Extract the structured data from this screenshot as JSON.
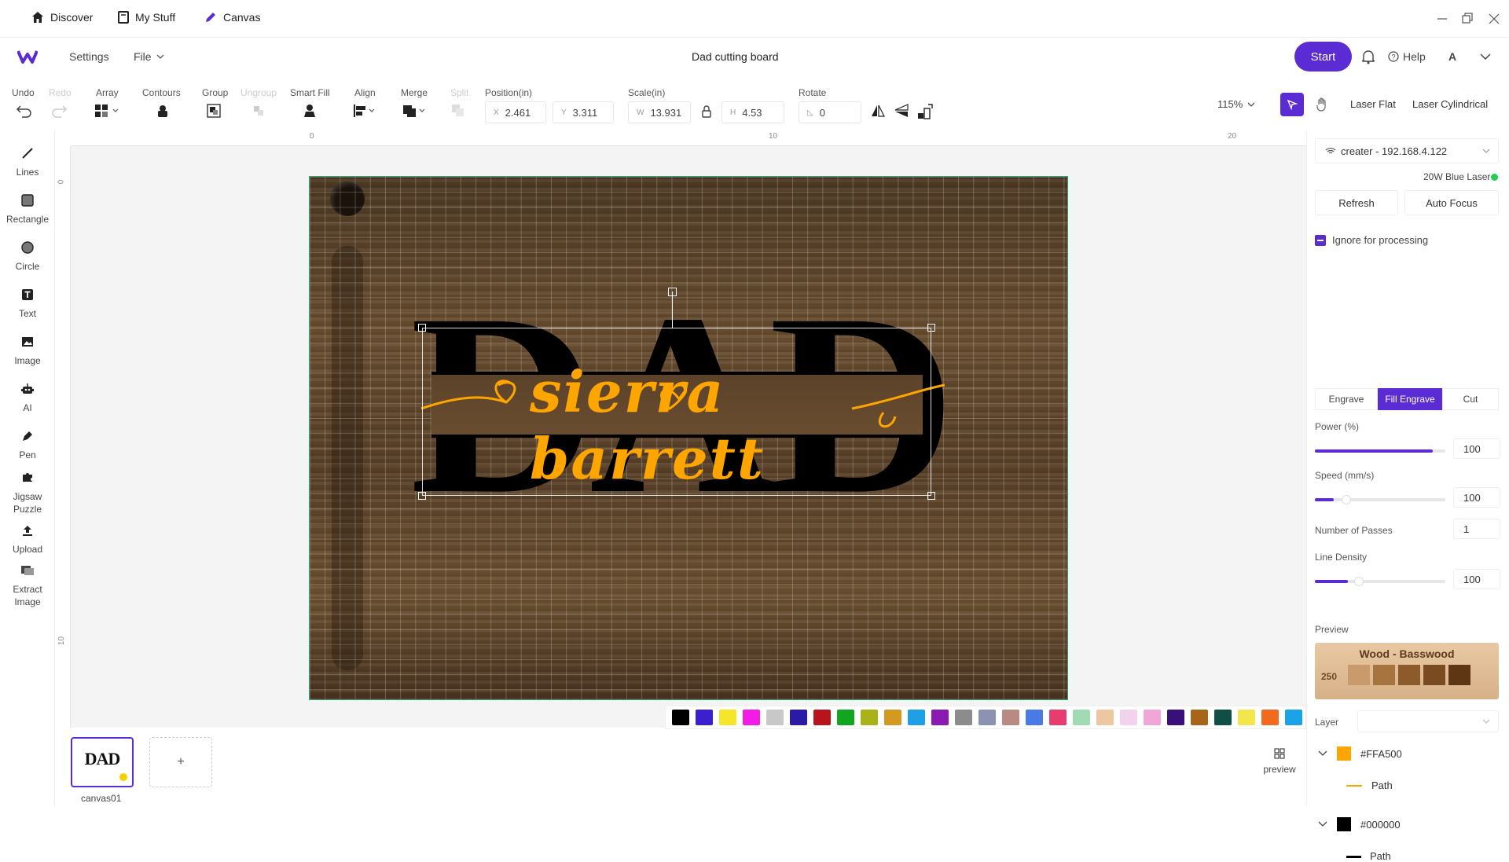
{
  "titlebar": {
    "nav": [
      {
        "label": "Discover",
        "icon": "home-icon"
      },
      {
        "label": "My Stuff",
        "icon": "book-icon"
      },
      {
        "label": "Canvas",
        "icon": "pencil-icon"
      }
    ]
  },
  "header": {
    "menu_settings": "Settings",
    "menu_file": "File",
    "project_title": "Dad cutting board",
    "start_label": "Start",
    "help_label": "Help",
    "account_letter": "A"
  },
  "toolbar": {
    "undo": "Undo",
    "redo": "Redo",
    "array": "Array",
    "contours": "Contours",
    "group": "Group",
    "ungroup": "Ungroup",
    "smart_fill": "Smart Fill",
    "align": "Align",
    "merge": "Merge",
    "split": "Split",
    "position_label": "Position(in)",
    "pos_x_prefix": "X",
    "pos_x": "2.461",
    "pos_y_prefix": "Y",
    "pos_y": "3.311",
    "scale_label": "Scale(in)",
    "scale_w_prefix": "W",
    "scale_w": "13.931",
    "scale_h_prefix": "H",
    "scale_h": "4.53",
    "rotate_label": "Rotate",
    "rotate_value": "0",
    "zoom": "115%",
    "mode_flat": "Laser Flat",
    "mode_cyl": "Laser Cylindrical"
  },
  "tools": [
    {
      "label": "Lines",
      "icon": "line-icon"
    },
    {
      "label": "Rectangle",
      "icon": "rectangle-icon"
    },
    {
      "label": "Circle",
      "icon": "circle-icon"
    },
    {
      "label": "Text",
      "icon": "text-icon"
    },
    {
      "label": "Image",
      "icon": "image-icon"
    },
    {
      "label": "AI",
      "icon": "robot-icon"
    },
    {
      "label": "Pen",
      "icon": "pen-icon"
    },
    {
      "label": "Jigsaw Puzzle",
      "icon": "puzzle-icon"
    },
    {
      "label": "Upload",
      "icon": "upload-icon"
    },
    {
      "label": "Extract Image",
      "icon": "extract-icon"
    }
  ],
  "rulers": {
    "top": [
      "0",
      "10",
      "20"
    ],
    "left": [
      "0",
      "10"
    ]
  },
  "design": {
    "main_text": "DAD",
    "script_text": "sierra barrett"
  },
  "palette": [
    "#000000",
    "#3b1fd1",
    "#f5e62b",
    "#f21ce6",
    "#c8c8c8",
    "#2b1aa8",
    "#b8141c",
    "#12a51f",
    "#a9b217",
    "#d39a1f",
    "#1ea0e6",
    "#8a1ab2",
    "#8c8c8c",
    "#8c93b2",
    "#b88a82",
    "#4b7ae6",
    "#e63c6e",
    "#9fdcb4",
    "#ecc8a0",
    "#f2d2ec",
    "#f2a6d8",
    "#3a0f7a",
    "#a8651a",
    "#0f4f46",
    "#f2e64a",
    "#f26a1e",
    "#1aa3e6"
  ],
  "canvas_tabs": [
    {
      "label": "canvas01"
    }
  ],
  "add_canvas": "+",
  "preview_button": "preview",
  "device": {
    "name": "creater - 192.168.4.122",
    "laser": "20W Blue Laser",
    "refresh": "Refresh",
    "autofocus": "Auto Focus"
  },
  "processing": {
    "ignore_label": "Ignore for processing",
    "tabs": [
      "Engrave",
      "Fill Engrave",
      "Cut"
    ],
    "active_tab": 1,
    "power_label": "Power (%)",
    "power_value": "100",
    "speed_label": "Speed (mm/s)",
    "speed_value": "100",
    "passes_label": "Number of Passes",
    "passes_value": "1",
    "density_label": "Line Density",
    "density_value": "100"
  },
  "preview": {
    "label": "Preview",
    "material": "Wood - Basswood",
    "num": "250"
  },
  "layers": {
    "label": "Layer",
    "items": [
      {
        "color": "#FFA500",
        "child": "Path"
      },
      {
        "color": "#000000",
        "child": "Path"
      }
    ]
  }
}
